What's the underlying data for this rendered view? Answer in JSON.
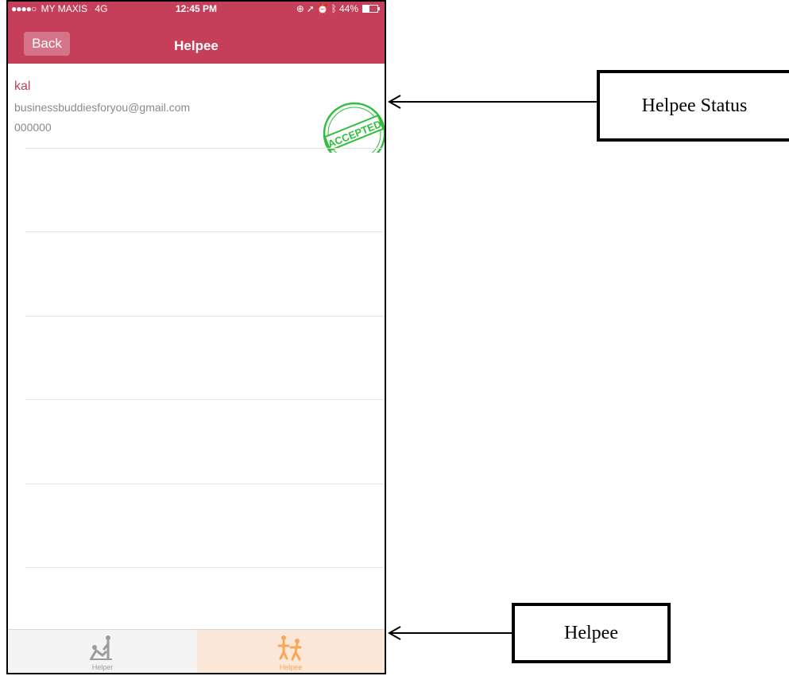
{
  "status_bar": {
    "signal_dots": "●●●●○",
    "carrier": "MY MAXIS",
    "network": "4G",
    "time": "12:45 PM",
    "battery": "44%",
    "battery_level": 0.44,
    "icons": [
      "lock-rotation-icon",
      "location-arrow-icon",
      "alarm-icon",
      "bluetooth-icon",
      "battery-icon"
    ]
  },
  "nav": {
    "back_label": "Back",
    "title": "Helpee"
  },
  "list": {
    "items": [
      {
        "name": "kal",
        "email": "businessbuddiesforyou@gmail.com",
        "phone": "000000",
        "status": "ACCEPTED"
      }
    ]
  },
  "tabs": [
    {
      "label": "Helper",
      "icon": "helper-icon",
      "selected": false
    },
    {
      "label": "Helpee",
      "icon": "helpee-icon",
      "selected": true
    }
  ],
  "colors": {
    "brand": "#c53f5a",
    "accepted_stamp": "#2fbf3a",
    "tab_active": "#f7a65a",
    "tab_inactive": "#9b9b9b"
  },
  "annotations": {
    "status_label": "Helpee Status",
    "tab_label": "Helpee"
  }
}
